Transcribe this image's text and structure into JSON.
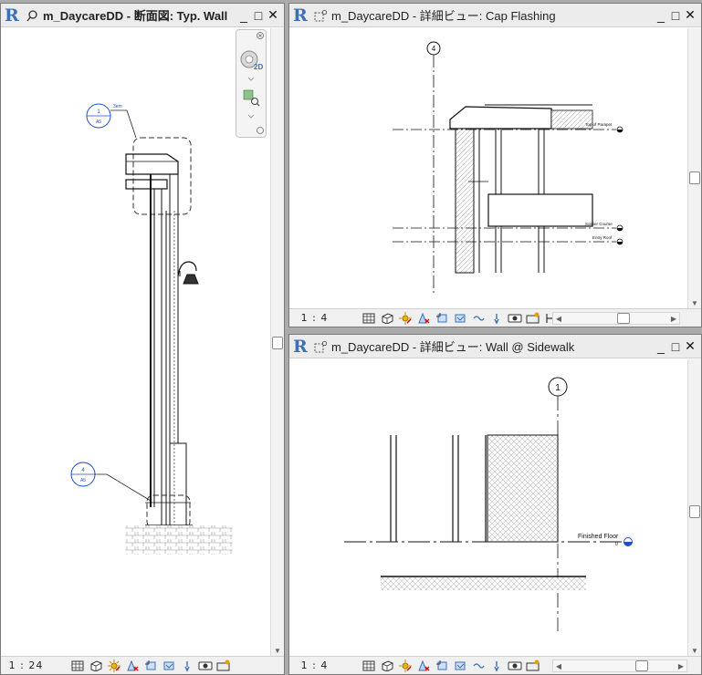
{
  "colors": {
    "revit_blue": "#3b6fb6",
    "annotation_blue": "#1f4fd0",
    "titlebar_bg": "#ececec",
    "window_bg": "#ababab"
  },
  "views": {
    "section": {
      "title": "m_DaycareDD - 断面図: Typ. Wall",
      "view_icon": "section-view-icon",
      "scale": "1 : 24",
      "callout_top_label": "1",
      "callout_top_sheet": "A5",
      "callout_top_text": "3em",
      "callout_bottom_label": "4",
      "callout_bottom_sheet": "A5"
    },
    "cap": {
      "title": "m_DaycareDD - 詳細ビュー: Cap Flashing",
      "view_icon": "detail-view-icon",
      "scale": "1 : 4",
      "grid_bubble": "4",
      "level1_name": "Top of Parapet",
      "level2_name": "Soldier Course",
      "level3_name": "Entry Roof"
    },
    "wall": {
      "title": "m_DaycareDD - 詳細ビュー: Wall @ Sidewalk",
      "view_icon": "detail-view-icon",
      "scale": "1 : 4",
      "grid_bubble": "1",
      "level_name": "Finished Floor",
      "level_value": "0"
    }
  },
  "window_buttons": {
    "minimize": "_",
    "maximize": "□",
    "close": "✕"
  },
  "scroll_arrows": {
    "up": "▲",
    "down": "▼",
    "left": "◀",
    "right": "▶"
  },
  "view_control_icons": [
    "detail-level-icon",
    "visual-style-icon",
    "sun-path-icon",
    "shadows-icon",
    "crop-view-icon",
    "show-crop-icon",
    "temporary-hide-icon",
    "reveal-hidden-icon",
    "worksharing-icon",
    "design-options-icon",
    "analytical-model-icon"
  ]
}
